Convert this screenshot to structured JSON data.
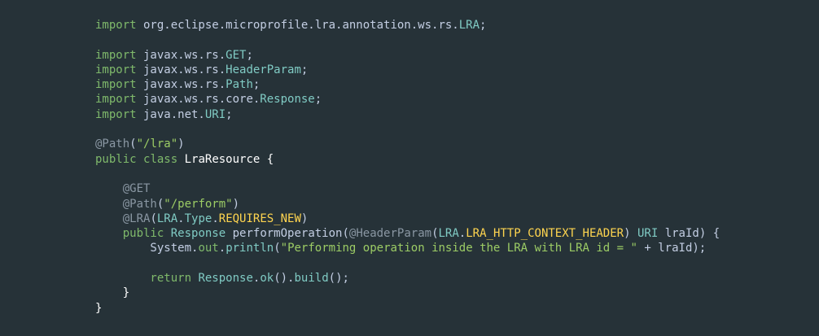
{
  "theme": {
    "background": "#263238",
    "keyword": "#89a9d8",
    "keyword_alt": "#7fb96b",
    "text": "#c3cee3",
    "class_name": "#80cbc4",
    "method": "#b9d78c",
    "string": "#9ccc65",
    "annotation": "#8a97a3",
    "constant": "#ffd54f",
    "field": "#80cbc4"
  },
  "code": {
    "lines": [
      {
        "tokens": [
          {
            "text": "import",
            "color": "#7fb96b"
          },
          {
            "text": " org.eclipse.microprofile.lra.annotation.ws.rs.",
            "color": "#c3cee3"
          },
          {
            "text": "LRA",
            "color": "#80cbc4"
          },
          {
            "text": ";",
            "color": "#c3cee3"
          }
        ]
      },
      {
        "tokens": []
      },
      {
        "tokens": [
          {
            "text": "import",
            "color": "#7fb96b"
          },
          {
            "text": " javax.ws.rs.",
            "color": "#c3cee3"
          },
          {
            "text": "GET",
            "color": "#80cbc4"
          },
          {
            "text": ";",
            "color": "#c3cee3"
          }
        ]
      },
      {
        "tokens": [
          {
            "text": "import",
            "color": "#7fb96b"
          },
          {
            "text": " javax.ws.rs.",
            "color": "#c3cee3"
          },
          {
            "text": "HeaderParam",
            "color": "#80cbc4"
          },
          {
            "text": ";",
            "color": "#c3cee3"
          }
        ]
      },
      {
        "tokens": [
          {
            "text": "import",
            "color": "#7fb96b"
          },
          {
            "text": " javax.ws.rs.",
            "color": "#c3cee3"
          },
          {
            "text": "Path",
            "color": "#80cbc4"
          },
          {
            "text": ";",
            "color": "#c3cee3"
          }
        ]
      },
      {
        "tokens": [
          {
            "text": "import",
            "color": "#7fb96b"
          },
          {
            "text": " javax.ws.rs.core.",
            "color": "#c3cee3"
          },
          {
            "text": "Response",
            "color": "#80cbc4"
          },
          {
            "text": ";",
            "color": "#c3cee3"
          }
        ]
      },
      {
        "tokens": [
          {
            "text": "import",
            "color": "#7fb96b"
          },
          {
            "text": " java.net.",
            "color": "#c3cee3"
          },
          {
            "text": "URI",
            "color": "#80cbc4"
          },
          {
            "text": ";",
            "color": "#c3cee3"
          }
        ]
      },
      {
        "tokens": []
      },
      {
        "tokens": [
          {
            "text": "@Path",
            "color": "#8a97a3"
          },
          {
            "text": "(",
            "color": "#c3cee3"
          },
          {
            "text": "\"/lra\"",
            "color": "#9ccc65"
          },
          {
            "text": ")",
            "color": "#c3cee3"
          }
        ]
      },
      {
        "tokens": [
          {
            "text": "public",
            "color": "#7fb96b"
          },
          {
            "text": " ",
            "color": "#c3cee3"
          },
          {
            "text": "class",
            "color": "#7fb96b"
          },
          {
            "text": " LraResource {",
            "color": "#ffffff"
          }
        ]
      },
      {
        "tokens": []
      },
      {
        "tokens": [
          {
            "text": "    @GET",
            "color": "#8a97a3"
          }
        ]
      },
      {
        "tokens": [
          {
            "text": "    @Path",
            "color": "#8a97a3"
          },
          {
            "text": "(",
            "color": "#c3cee3"
          },
          {
            "text": "\"/perform\"",
            "color": "#9ccc65"
          },
          {
            "text": ")",
            "color": "#c3cee3"
          }
        ]
      },
      {
        "tokens": [
          {
            "text": "    @LRA",
            "color": "#8a97a3"
          },
          {
            "text": "(",
            "color": "#c3cee3"
          },
          {
            "text": "LRA",
            "color": "#80cbc4"
          },
          {
            "text": ".",
            "color": "#c3cee3"
          },
          {
            "text": "Type",
            "color": "#80cbc4"
          },
          {
            "text": ".",
            "color": "#c3cee3"
          },
          {
            "text": "REQUIRES_NEW",
            "color": "#ffd54f"
          },
          {
            "text": ")",
            "color": "#c3cee3"
          }
        ]
      },
      {
        "tokens": [
          {
            "text": "    public",
            "color": "#7fb96b"
          },
          {
            "text": " ",
            "color": "#c3cee3"
          },
          {
            "text": "Response",
            "color": "#80cbc4"
          },
          {
            "text": " ",
            "color": "#c3cee3"
          },
          {
            "text": "performOperation",
            "color": "#c3cee3"
          },
          {
            "text": "(",
            "color": "#c3cee3"
          },
          {
            "text": "@HeaderParam",
            "color": "#8a97a3"
          },
          {
            "text": "(",
            "color": "#c3cee3"
          },
          {
            "text": "LRA",
            "color": "#80cbc4"
          },
          {
            "text": ".",
            "color": "#c3cee3"
          },
          {
            "text": "LRA_HTTP_CONTEXT_HEADER",
            "color": "#ffd54f"
          },
          {
            "text": ") ",
            "color": "#c3cee3"
          },
          {
            "text": "URI",
            "color": "#80cbc4"
          },
          {
            "text": " lraId) {",
            "color": "#c3cee3"
          }
        ]
      },
      {
        "tokens": [
          {
            "text": "        System",
            "color": "#c3cee3"
          },
          {
            "text": ".",
            "color": "#c3cee3"
          },
          {
            "text": "out",
            "color": "#7fb96b"
          },
          {
            "text": ".",
            "color": "#c3cee3"
          },
          {
            "text": "println",
            "color": "#80cbc4"
          },
          {
            "text": "(",
            "color": "#c3cee3"
          },
          {
            "text": "\"Performing operation inside the LRA with LRA id = \"",
            "color": "#9ccc65"
          },
          {
            "text": " + lraId);",
            "color": "#c3cee3"
          }
        ]
      },
      {
        "tokens": []
      },
      {
        "tokens": [
          {
            "text": "        return",
            "color": "#7fb96b"
          },
          {
            "text": " ",
            "color": "#c3cee3"
          },
          {
            "text": "Response",
            "color": "#80cbc4"
          },
          {
            "text": ".",
            "color": "#c3cee3"
          },
          {
            "text": "ok",
            "color": "#80cbc4"
          },
          {
            "text": "().",
            "color": "#c3cee3"
          },
          {
            "text": "build",
            "color": "#80cbc4"
          },
          {
            "text": "();",
            "color": "#c3cee3"
          }
        ]
      },
      {
        "tokens": [
          {
            "text": "    }",
            "color": "#ffffff"
          }
        ]
      },
      {
        "tokens": [
          {
            "text": "}",
            "color": "#ffffff"
          }
        ]
      }
    ]
  }
}
